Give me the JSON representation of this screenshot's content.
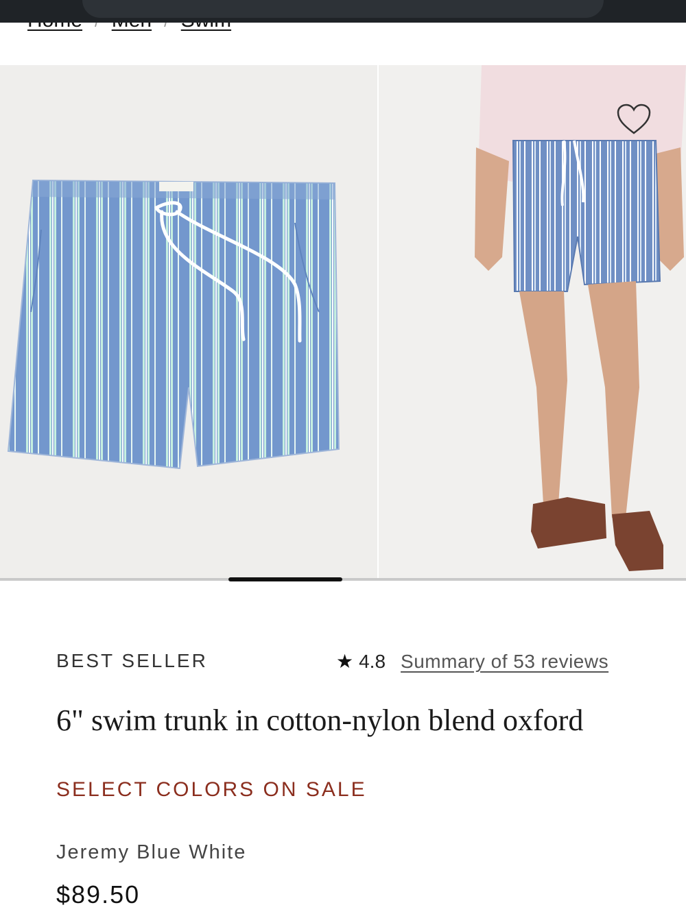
{
  "breadcrumb": {
    "items": [
      "Home",
      "Men",
      "Swim"
    ],
    "separator": "/"
  },
  "gallery": {
    "slides": [
      {
        "alt": "flat lay of striped swim trunk"
      },
      {
        "alt": "model wearing striped swim trunk"
      }
    ],
    "active_index": 1,
    "total": 6
  },
  "product": {
    "badge": "BEST SELLER",
    "rating": "4.8",
    "reviews_link": "Summary of 53 reviews",
    "title": "6\" swim trunk in cotton-nylon blend oxford",
    "sale_text": "SELECT COLORS ON SALE",
    "color_name": "Jeremy Blue White",
    "price": "$89.50"
  },
  "colors": {
    "sale": "#8b2e1e",
    "stripe_blue": "#6f93c9",
    "stripe_mint": "#bfeedd"
  },
  "icons": {
    "wishlist": "heart-icon",
    "rating": "star-icon"
  }
}
